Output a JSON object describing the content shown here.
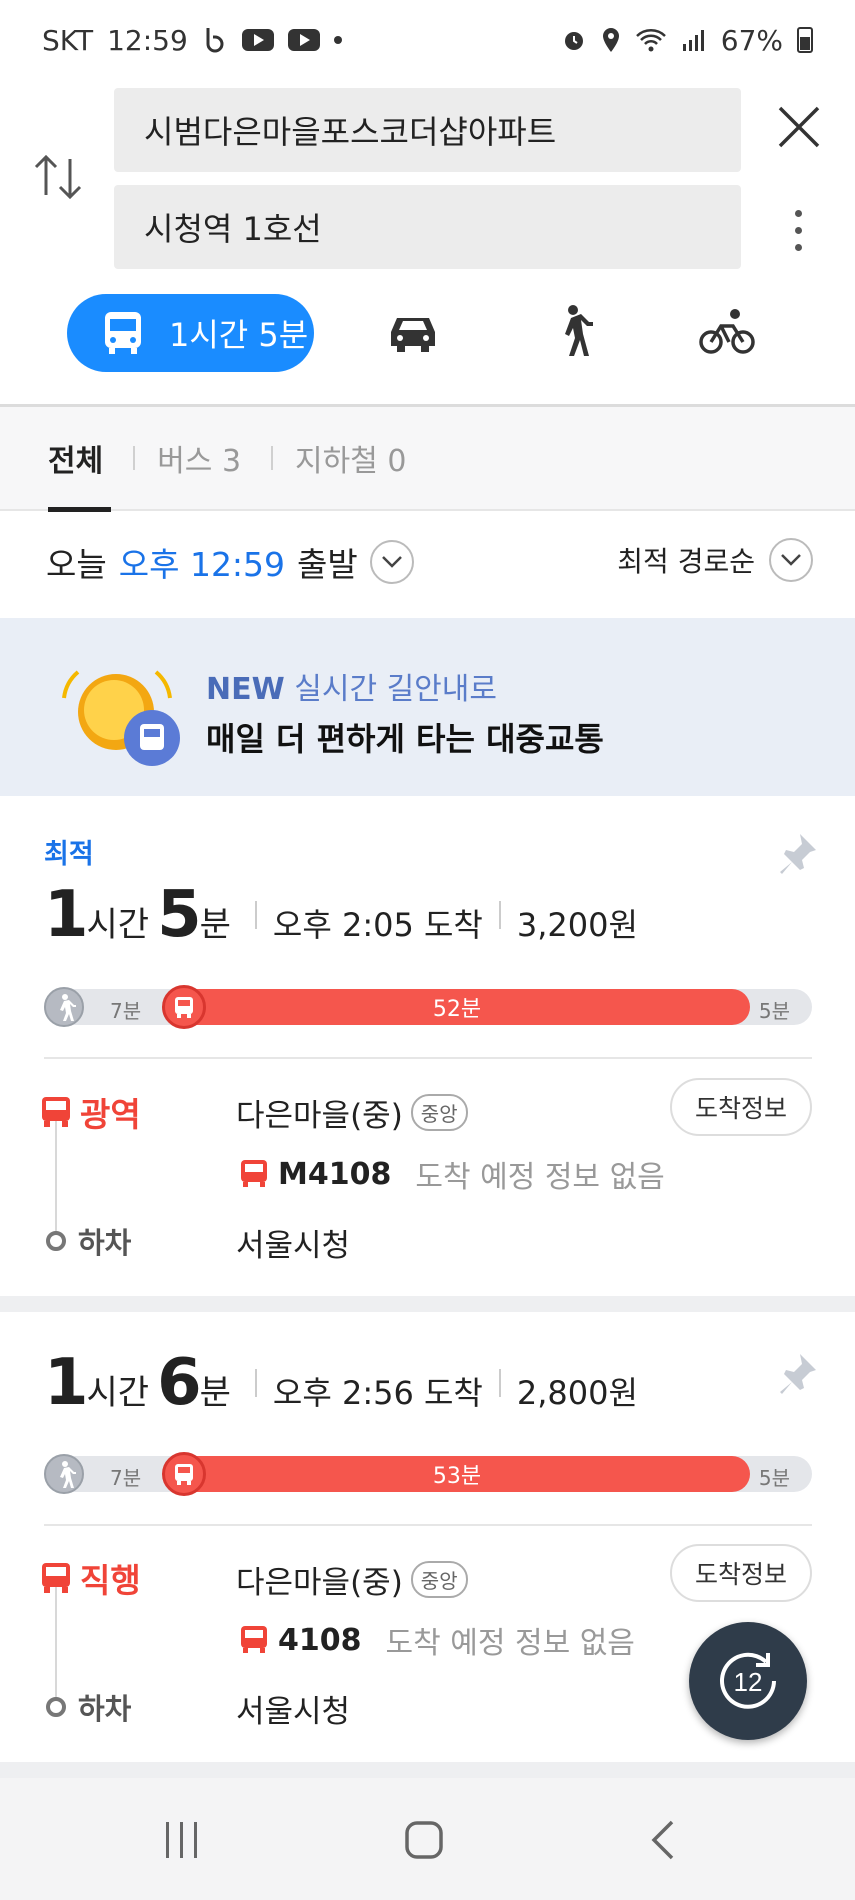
{
  "status_bar": {
    "carrier": "SKT",
    "time": "12:59",
    "battery": "67%"
  },
  "search": {
    "origin": "시범다은마을포스코더샵아파트",
    "destination": "시청역 1호선"
  },
  "modes": {
    "transit_time": "1시간 5분"
  },
  "tabs": [
    {
      "label": "전체"
    },
    {
      "label": "버스 3"
    },
    {
      "label": "지하철 0"
    }
  ],
  "depart": {
    "today": "오늘",
    "time": "오후 12:59",
    "suffix": "출발"
  },
  "sort": {
    "label": "최적 경로순"
  },
  "banner": {
    "new": "NEW",
    "title": "실시간 길안내로",
    "subtitle": "매일 더 편하게 타는 대중교통"
  },
  "routes": [
    {
      "badge": "최적",
      "hours": "1",
      "hours_unit": "시간",
      "minutes": "5",
      "minutes_unit": "분",
      "arrival": "오후 2:05 도착",
      "fare": "3,200원",
      "walk1": "7분",
      "bus_mins": "52분",
      "walk2": "5분",
      "type_label": "광역",
      "board_stop": "다은마을(중)",
      "stop_tag": "중앙",
      "arrive_btn": "도착정보",
      "bus_number": "M4108",
      "bus_status": "도착 예정 정보 없음",
      "off_label": "하차",
      "off_stop": "서울시청"
    },
    {
      "hours": "1",
      "hours_unit": "시간",
      "minutes": "6",
      "minutes_unit": "분",
      "arrival": "오후 2:56 도착",
      "fare": "2,800원",
      "walk1": "7분",
      "bus_mins": "53분",
      "walk2": "5분",
      "type_label": "직행",
      "board_stop": "다은마을(중)",
      "stop_tag": "중앙",
      "arrive_btn": "도착정보",
      "bus_number": "4108",
      "bus_status": "도착 예정 정보 없음",
      "off_label": "하차",
      "off_stop": "서울시청"
    }
  ],
  "fab": {
    "label": "12"
  },
  "colors": {
    "accent": "#1a8cff",
    "bus_red": "#f5564d",
    "banner_bg": "#e9eef6"
  }
}
